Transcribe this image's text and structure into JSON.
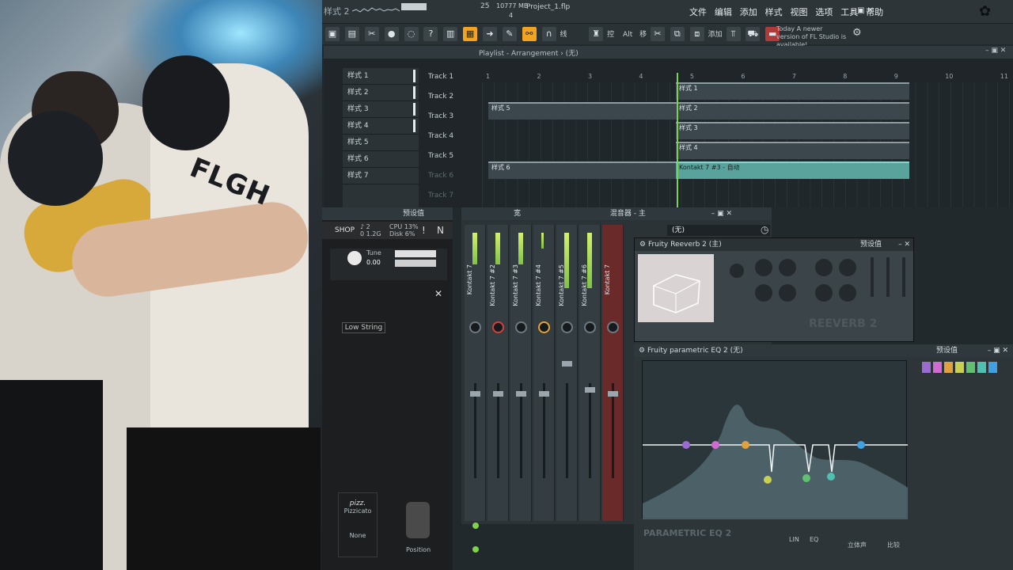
{
  "app": {
    "pattern_selector": "样式 2",
    "counter_left": "25",
    "memory": "10777 MB",
    "counter_right": "4",
    "project_file": "Project_1.flp",
    "menu": [
      "文件",
      "编辑",
      "添加",
      "样式",
      "视图",
      "选项",
      "工具",
      "帮助"
    ],
    "news": "Today  A newer version of FL Studio is available!",
    "toolbar_labels": {
      "snap": "线",
      "pen": "控",
      "alt": "Alt",
      "move": "移",
      "add": "添加"
    }
  },
  "playlist": {
    "title": "Playlist - Arrangement › (无)",
    "patterns": [
      "样式 1",
      "样式 2",
      "样式 3",
      "样式 4",
      "样式 5",
      "样式 6",
      "样式 7"
    ],
    "tracks": [
      "Track 1",
      "Track 2",
      "Track 3",
      "Track 4",
      "Track 5",
      "Track 6",
      "Track 7"
    ],
    "ruler": [
      "1",
      "2",
      "3",
      "4",
      "5",
      "6",
      "7",
      "8",
      "9",
      "10",
      "11"
    ],
    "clips": {
      "c1": "样式 1",
      "c2": "样式 2",
      "c2a": "样式 5",
      "c3": "样式 3",
      "c4": "样式 4",
      "c6": "样式 6",
      "c5": "Kontakt 7 #3 - 自动"
    }
  },
  "kontakt": {
    "header_label": "预设值",
    "shop": "SHOP",
    "cpu": "CPU 13%",
    "disk": "Disk 6%",
    "voices": "♪ 2",
    "mem": "0 1.2G",
    "tune_label": "Tune",
    "tune_value": "0.00",
    "articulation": "Low String",
    "pizz_title": "pizz.",
    "pizz_label": "Pizzicato",
    "none_label": "None",
    "position_label": "Position"
  },
  "mixer": {
    "title": "混音器 - 主",
    "tab": "宽",
    "preset": "(无)",
    "channels": [
      "Kontakt 7",
      "Kontakt 7 #2",
      "Kontakt 7 #3",
      "Kontakt 7 #4",
      "Kontakt 7 #5",
      "Kontakt 7 #6",
      "Kontakt 7"
    ],
    "numbers": [
      "1",
      "2",
      "3",
      "4",
      "5",
      "6",
      "7",
      "8"
    ]
  },
  "reverb": {
    "title": "Fruity Reeverb 2 (主)",
    "preset_label": "预设值",
    "knobs": [
      "低切",
      "高切",
      "延迟",
      "大小",
      "扩散",
      "低频",
      "高频",
      "衰减时间",
      "湿度",
      "早反",
      "混合"
    ],
    "brand": "REEVERB 2"
  },
  "eq": {
    "title": "Fruity parametric EQ 2 (无)",
    "preset_label": "预设值",
    "bands": [
      "1",
      "2",
      "3",
      "4",
      "5",
      "6",
      "7"
    ],
    "brand": "PARAMETRIC EQ 2",
    "footer": [
      "LIN",
      "EQ",
      "立体声",
      "比较"
    ],
    "colors": [
      "#9b6bd1",
      "#d16bd1",
      "#e0a040",
      "#c8d050",
      "#60c070",
      "#50c0b0",
      "#40a0e0"
    ]
  }
}
